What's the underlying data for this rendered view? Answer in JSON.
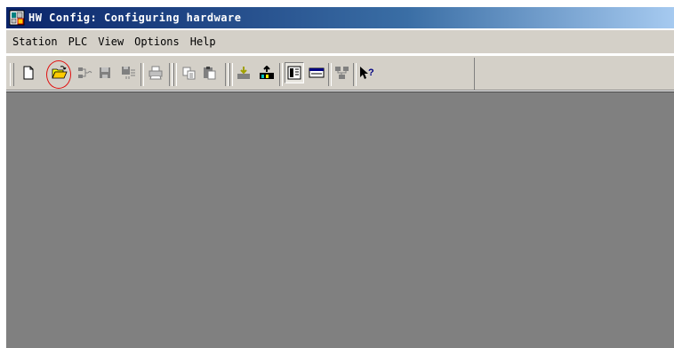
{
  "window": {
    "title": "HW Config: Configuring hardware",
    "icon": "hw-config-app-icon"
  },
  "menubar": {
    "items": [
      "Station",
      "PLC",
      "View",
      "Options",
      "Help"
    ]
  },
  "toolbar": {
    "buttons": [
      {
        "name": "new",
        "icon": "new-document-icon"
      },
      {
        "name": "open",
        "icon": "open-folder-icon",
        "highlighted": true
      },
      {
        "name": "accessible-nodes",
        "icon": "network-nodes-icon"
      },
      {
        "name": "save",
        "icon": "save-icon"
      },
      {
        "name": "save-and-compile",
        "icon": "save-compile-icon"
      },
      {
        "name": "print",
        "icon": "print-icon"
      },
      {
        "name": "copy",
        "icon": "copy-icon"
      },
      {
        "name": "paste",
        "icon": "paste-icon"
      },
      {
        "name": "download",
        "icon": "download-to-module-icon"
      },
      {
        "name": "upload",
        "icon": "upload-to-pg-icon"
      },
      {
        "name": "catalog",
        "icon": "catalog-icon",
        "pressed": true
      },
      {
        "name": "module-view",
        "icon": "module-view-icon"
      },
      {
        "name": "netpro",
        "icon": "netpro-icon"
      },
      {
        "name": "help",
        "icon": "context-help-icon"
      }
    ]
  },
  "colors": {
    "title_bar": "#0a246a",
    "face": "#d4d0c8",
    "workspace": "#808080",
    "highlight_ring": "#e01010"
  }
}
